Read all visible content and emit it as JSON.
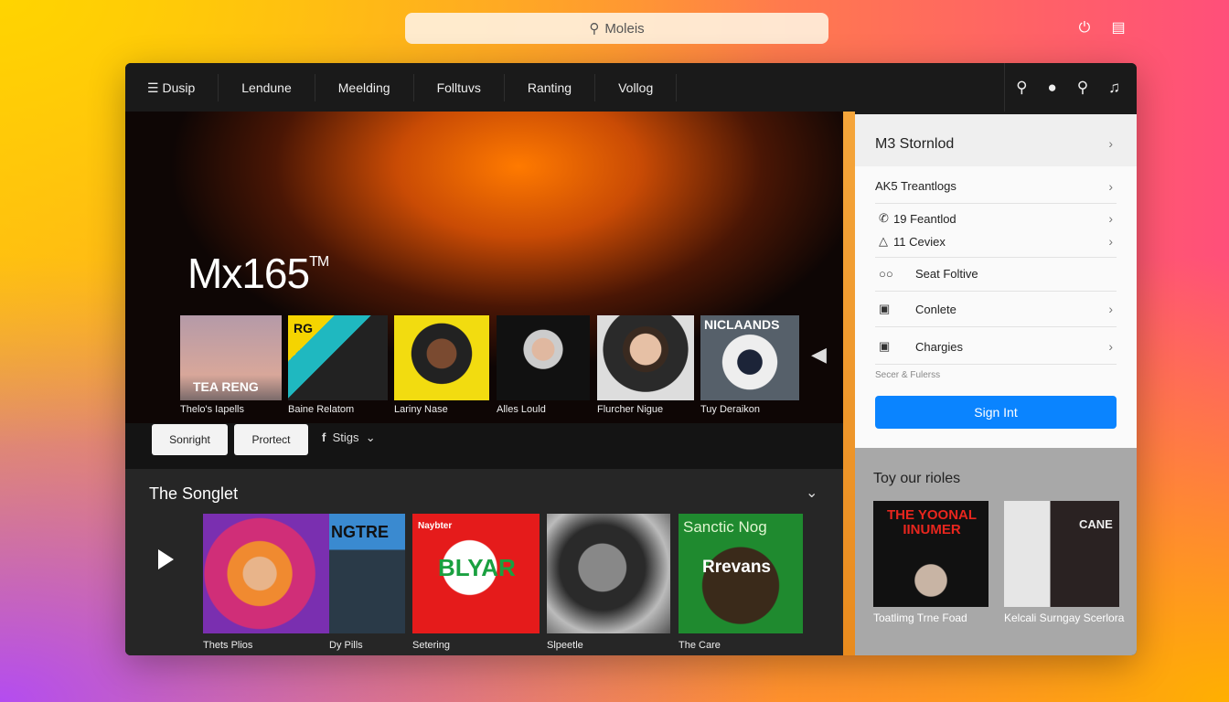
{
  "search": {
    "placeholder": "Moleis",
    "icon": "search-icon"
  },
  "system": {
    "power_icon": "power-icon",
    "window_icon": "window-icon"
  },
  "nav": {
    "menu_label": "Dusip",
    "items": [
      "Lendune",
      "Meelding",
      "Folltuvs",
      "Ranting",
      "Vollog"
    ],
    "icons": [
      "search-icon",
      "apple-icon",
      "search-icon",
      "music-note-icon"
    ]
  },
  "hero": {
    "title": "Mx165",
    "trademark": "TM",
    "artists": [
      {
        "name": "Thelo's Iapells",
        "cover_text": "TEA RENG"
      },
      {
        "name": "Baine Relatom",
        "cover_text": "RG"
      },
      {
        "name": "Lariny Nase"
      },
      {
        "name": "Alles Lould"
      },
      {
        "name": "Flurcher Nigue"
      },
      {
        "name": "Tuy Deraikon",
        "cover_text": "NICLAANDS"
      }
    ]
  },
  "actions": {
    "button1": "Sonright",
    "button2": "Prortect",
    "dropdown": "Stigs"
  },
  "songlet": {
    "title": "The Songlet",
    "cards": [
      {
        "name": "Thets Plios"
      },
      {
        "name": "Dy Pills",
        "cover_text": "NGTRE"
      },
      {
        "name": "Setering",
        "cover_text": "BLYAR",
        "cover_sub": "Naybter"
      },
      {
        "name": "Slpeetle"
      },
      {
        "name": "The Care",
        "cover_text": "Rrevans",
        "cover_sub": "Sanctic Nog"
      }
    ]
  },
  "panel": {
    "header": "M3 Stornlod",
    "rows": [
      {
        "label": "AK5 Treantlogs"
      },
      {
        "label": "19 Feantlod",
        "icon": "phone-icon"
      },
      {
        "label": "11 Ceviex",
        "icon": "tag-icon"
      },
      {
        "label": "Seat Foltive",
        "icon": "link-icon"
      },
      {
        "label": "Conlete",
        "icon": "square-icon"
      },
      {
        "label": "Chargies",
        "icon": "clipboard-icon"
      }
    ],
    "note": "Secer & Fulerss",
    "signin": "Sign Int",
    "accent": "#0a84ff"
  },
  "roles": {
    "title": "Toy our rioles",
    "cards": [
      {
        "name": "Toatlimg Trne Foad",
        "cover_text": "THE YOONAL IINUMER"
      },
      {
        "name": "Kelcali Surngay Scerlora",
        "cover_text": "CANE"
      }
    ]
  }
}
